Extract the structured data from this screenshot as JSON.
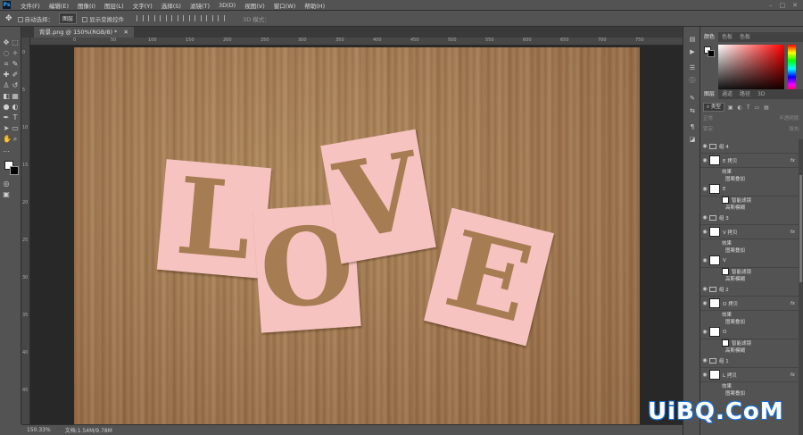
{
  "menubar": {
    "logo": "Ps",
    "items": [
      "文件(F)",
      "编辑(E)",
      "图像(I)",
      "图层(L)",
      "文字(Y)",
      "选择(S)",
      "滤镜(T)",
      "3D(D)",
      "视图(V)",
      "窗口(W)",
      "帮助(H)"
    ]
  },
  "options_bar": {
    "auto_select_label": "自动选择：",
    "auto_select_value": "图层",
    "show_transform_label": "显示变换控件",
    "mode_3d_label": "3D 模式："
  },
  "document_tab": {
    "label": "背景.png @ 150%(RGB/8) *"
  },
  "ruler": {
    "top_ticks": [
      "0",
      "50",
      "100",
      "150",
      "200",
      "250",
      "300",
      "350",
      "400",
      "450",
      "500",
      "550",
      "600",
      "650",
      "700",
      "750"
    ],
    "left_ticks": [
      "0",
      "5",
      "10",
      "15",
      "20",
      "25",
      "30",
      "35",
      "40",
      "45"
    ]
  },
  "canvas": {
    "cards": [
      {
        "letter": "L"
      },
      {
        "letter": "O"
      },
      {
        "letter": "V"
      },
      {
        "letter": "E"
      }
    ],
    "colors": {
      "card": "#f6c3c0",
      "cardboard": "#a67c52"
    }
  },
  "status_bar": {
    "zoom": "150.33%",
    "doc_size": "文档:1.54M/9.78M"
  },
  "panels": {
    "color_tabs": [
      "颜色",
      "色板",
      "色板"
    ],
    "layer_tabs": [
      "图层",
      "通道",
      "路径",
      "3D"
    ],
    "filter_kind": "类型",
    "blend_mode": "正常",
    "opacity_label": "不透明度:",
    "lock_label": "锁定:",
    "fill_label": "填充:"
  },
  "layers": [
    {
      "type": "group",
      "name": "组 4"
    },
    {
      "type": "layer",
      "name": "E 拷贝",
      "fx": "fx"
    },
    {
      "type": "sub",
      "name": "效果"
    },
    {
      "type": "sub",
      "name": "图案叠加"
    },
    {
      "type": "smart",
      "name": "E"
    },
    {
      "type": "sub",
      "name": "智能滤镜"
    },
    {
      "type": "sub",
      "name": "高斯模糊"
    },
    {
      "type": "group",
      "name": "组 3"
    },
    {
      "type": "layer",
      "name": "V 拷贝",
      "fx": "fx"
    },
    {
      "type": "sub",
      "name": "效果"
    },
    {
      "type": "sub",
      "name": "图案叠加"
    },
    {
      "type": "smart",
      "name": "V"
    },
    {
      "type": "sub",
      "name": "智能滤镜"
    },
    {
      "type": "sub",
      "name": "高斯模糊"
    },
    {
      "type": "group",
      "name": "组 2"
    },
    {
      "type": "layer",
      "name": "O 拷贝",
      "fx": "fx"
    },
    {
      "type": "sub",
      "name": "效果"
    },
    {
      "type": "sub",
      "name": "图案叠加"
    },
    {
      "type": "smart",
      "name": "O"
    },
    {
      "type": "sub",
      "name": "智能滤镜"
    },
    {
      "type": "sub",
      "name": "高斯模糊"
    },
    {
      "type": "group",
      "name": "组 1"
    },
    {
      "type": "layer",
      "name": "L 拷贝",
      "fx": "fx"
    },
    {
      "type": "sub",
      "name": "效果"
    },
    {
      "type": "sub",
      "name": "图案叠加"
    }
  ],
  "watermark": "UiBQ.CoM"
}
